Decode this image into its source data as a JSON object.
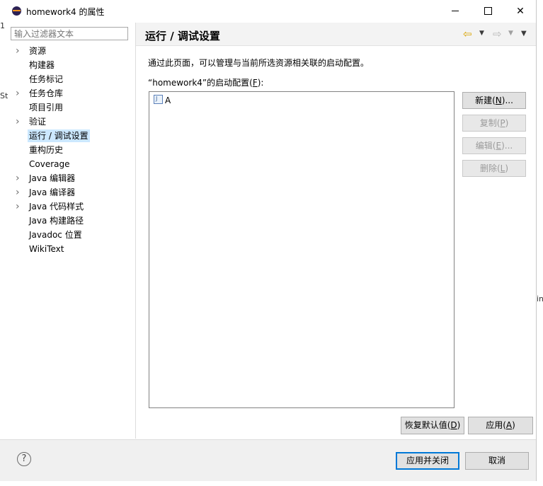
{
  "window": {
    "title": "homework4 的属性"
  },
  "left": {
    "filter_placeholder": "输入过滤器文本",
    "tree": [
      {
        "label": "资源",
        "expandable": true
      },
      {
        "label": "构建器",
        "expandable": false
      },
      {
        "label": "任务标记",
        "expandable": false
      },
      {
        "label": "任务仓库",
        "expandable": true
      },
      {
        "label": "项目引用",
        "expandable": false
      },
      {
        "label": "验证",
        "expandable": true
      },
      {
        "label": "运行 / 调试设置",
        "expandable": false,
        "selected": true
      },
      {
        "label": "重构历史",
        "expandable": false
      },
      {
        "label": "Coverage",
        "expandable": false
      },
      {
        "label": "Java 编辑器",
        "expandable": true
      },
      {
        "label": "Java 编译器",
        "expandable": true
      },
      {
        "label": "Java 代码样式",
        "expandable": true
      },
      {
        "label": "Java 构建路径",
        "expandable": false
      },
      {
        "label": "Javadoc 位置",
        "expandable": false
      },
      {
        "label": "WikiText",
        "expandable": false
      }
    ]
  },
  "header": {
    "title": "运行 / 调试设置"
  },
  "content": {
    "description": "通过此页面，可以管理与当前所选资源相关联的启动配置。",
    "list_label_prefix": "“homework4”的启动配置(",
    "list_label_mnemonic": "F",
    "list_label_suffix": "):",
    "configs": [
      {
        "name": "A",
        "icon": "java-app-icon"
      }
    ],
    "buttons": {
      "new": {
        "text": "新建(",
        "mn": "N",
        "end": ")..."
      },
      "copy": {
        "text": "复制(",
        "mn": "P",
        "end": ")"
      },
      "edit": {
        "text": "编辑(",
        "mn": "E",
        "end": ")..."
      },
      "delete": {
        "text": "删除(",
        "mn": "L",
        "end": ")"
      }
    },
    "restore": {
      "text": "恢复默认值(",
      "mn": "D",
      "end": ")"
    },
    "apply": {
      "text": "应用(",
      "mn": "A",
      "end": ")"
    }
  },
  "bottom": {
    "help": "?",
    "ok": "应用并关闭",
    "cancel": "取消"
  },
  "background_fragments": [
    "1",
    "St",
    "in"
  ]
}
